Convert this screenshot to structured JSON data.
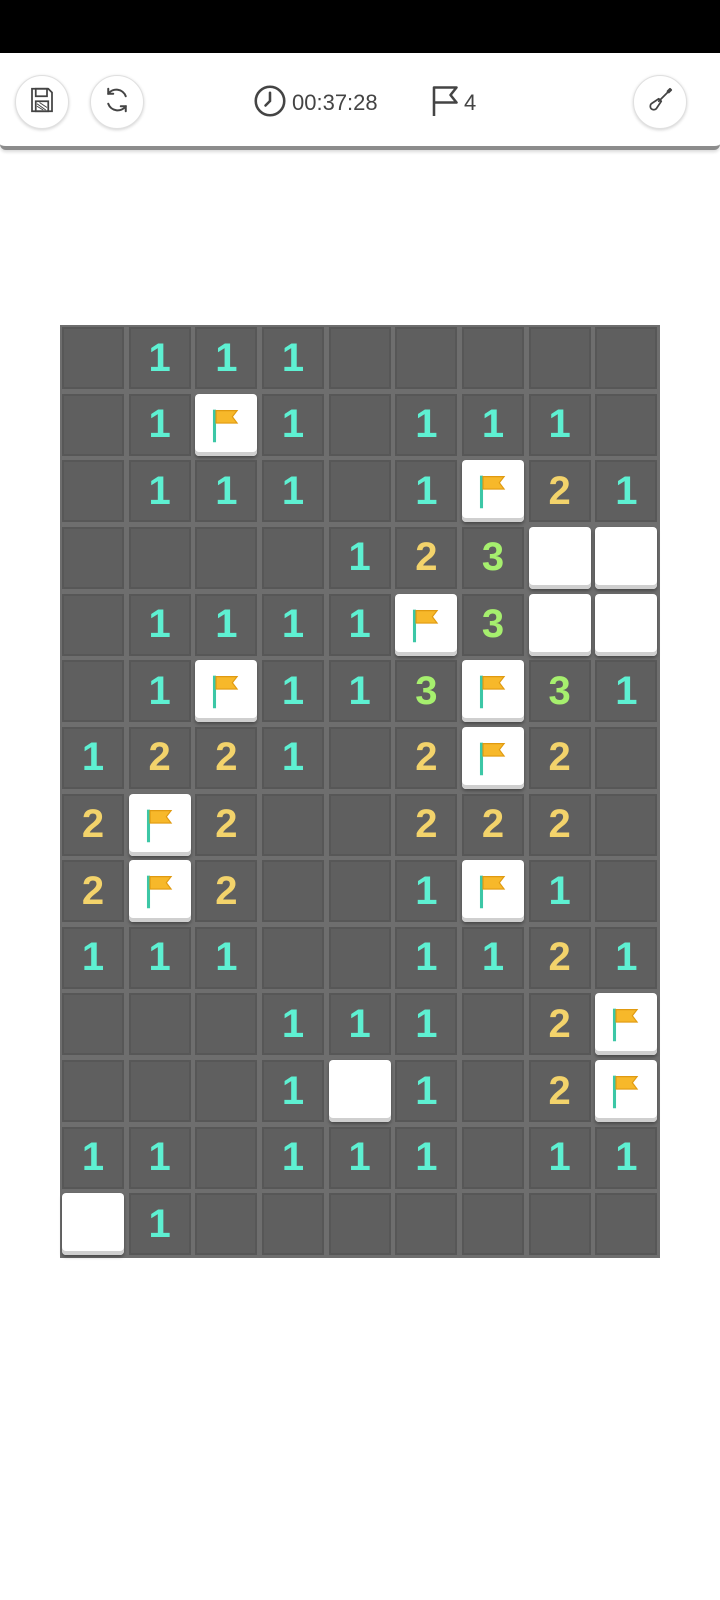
{
  "toolbar": {
    "timer": "00:37:28",
    "flags": "4",
    "icons": [
      "save-icon",
      "restart-icon",
      "clock-icon",
      "flag-icon",
      "shovel-icon"
    ]
  },
  "colors": {
    "num1": "#5ef0d2",
    "num2": "#f3d36b",
    "num3": "#a6ef6e",
    "flag_yellow": "#f7b82a",
    "flag_pole": "#3cc7a6",
    "hidden": "#5f5f5f",
    "grid": "#6e6e6e"
  },
  "board": {
    "cols": 9,
    "rows": 14,
    "legend": "H = hidden cell, F = flag, O = open blank, 1-3 = revealed number",
    "cells": [
      [
        "H",
        "1",
        "1",
        "1",
        "H",
        "H",
        "H",
        "H",
        "H"
      ],
      [
        "H",
        "1",
        "F",
        "1",
        "H",
        "1",
        "1",
        "1",
        "H"
      ],
      [
        "H",
        "1",
        "1",
        "1",
        "H",
        "1",
        "F",
        "2",
        "1"
      ],
      [
        "H",
        "H",
        "H",
        "H",
        "1",
        "2",
        "3",
        "O",
        "O"
      ],
      [
        "H",
        "1",
        "1",
        "1",
        "1",
        "F",
        "3",
        "O",
        "O"
      ],
      [
        "H",
        "1",
        "F",
        "1",
        "1",
        "3",
        "F",
        "3",
        "1"
      ],
      [
        "1",
        "2",
        "2",
        "1",
        "H",
        "2",
        "F",
        "2",
        "H"
      ],
      [
        "2",
        "F",
        "2",
        "H",
        "H",
        "2",
        "2",
        "2",
        "H"
      ],
      [
        "2",
        "F",
        "2",
        "H",
        "H",
        "1",
        "F",
        "1",
        "H"
      ],
      [
        "1",
        "1",
        "1",
        "H",
        "H",
        "1",
        "1",
        "2",
        "1"
      ],
      [
        "H",
        "H",
        "H",
        "1",
        "1",
        "1",
        "H",
        "2",
        "F"
      ],
      [
        "H",
        "H",
        "H",
        "1",
        "O",
        "1",
        "H",
        "2",
        "F"
      ],
      [
        "1",
        "1",
        "H",
        "1",
        "1",
        "1",
        "H",
        "1",
        "1"
      ],
      [
        "O",
        "1",
        "H",
        "H",
        "H",
        "H",
        "H",
        "H",
        "H"
      ]
    ]
  }
}
